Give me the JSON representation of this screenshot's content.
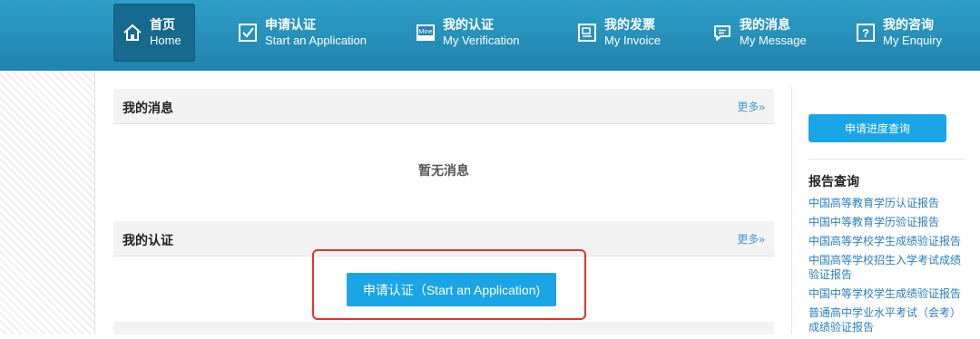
{
  "nav": {
    "items": [
      {
        "cn": "首页",
        "en": "Home",
        "icon": "home-icon"
      },
      {
        "cn": "申请认证",
        "en": "Start an Application",
        "icon": "checkbox-icon"
      },
      {
        "cn": "我的认证",
        "en": "My Verification",
        "icon": "mine-icon",
        "icon_text": "Mine"
      },
      {
        "cn": "我的发票",
        "en": "My Invoice",
        "icon": "invoice-icon"
      },
      {
        "cn": "我的消息",
        "en": "My Message",
        "icon": "message-icon"
      },
      {
        "cn": "我的咨询",
        "en": "My Enquiry",
        "icon": "question-icon"
      }
    ]
  },
  "messages": {
    "title": "我的消息",
    "more": "更多»",
    "empty": "暂无消息"
  },
  "verification": {
    "title": "我的认证",
    "more": "更多»",
    "apply_button": "申请认证（Start an Application)"
  },
  "sidebar": {
    "progress_button": "申请进度查询",
    "report_title": "报告查询",
    "reports": [
      "中国高等教育学历认证报告",
      "中国中等教育学历验证报告",
      "中国高等学校学生成绩验证报告",
      "中国高等学校招生入学考试成绩验证报告",
      "中国中等学校学生成绩验证报告",
      "普通高中学业水平考试（会考）成绩验证报告"
    ]
  },
  "colors": {
    "nav_bg": "#2596c0",
    "accent": "#1aa5e6",
    "link": "#2a7fc1",
    "highlight": "#e0332f"
  }
}
